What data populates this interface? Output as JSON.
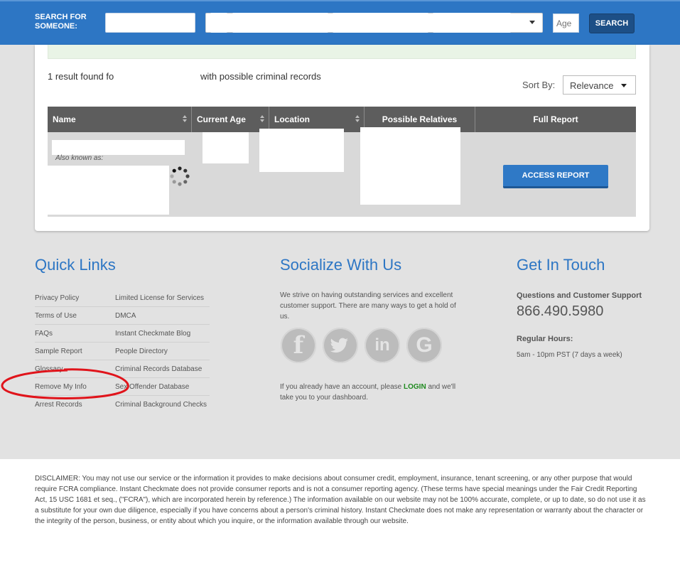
{
  "header": {
    "search_label": "SEARCH FOR SOMEONE:",
    "age_placeholder": "Age",
    "search_button": "SEARCH"
  },
  "results": {
    "count_text": "1 result found fo",
    "count_suffix": "with possible criminal records",
    "sort_label": "Sort By:",
    "sort_value": "Relevance",
    "columns": [
      "Name",
      "Current Age",
      "Location",
      "Possible Relatives",
      "Full Report"
    ],
    "row": {
      "aka_label": "Also known as:",
      "access_button": "ACCESS REPORT"
    }
  },
  "quick_links": {
    "title": "Quick Links",
    "left": [
      "Privacy Policy",
      "Terms of Use",
      "FAQs",
      "Sample Report",
      "Glossary",
      "Remove My Info",
      "Arrest Records"
    ],
    "right": [
      "Limited License for Services",
      "DMCA",
      "Instant Checkmate Blog",
      "People Directory",
      "Criminal Records Database",
      "Sex Offender Database",
      "Criminal Background Checks"
    ]
  },
  "social": {
    "title": "Socialize With Us",
    "text": "We strive on having outstanding services and excellent customer support. There are many ways to get a hold of us.",
    "icons": [
      "facebook-icon",
      "twitter-icon",
      "linkedin-icon",
      "google-icon"
    ],
    "login_prefix": "If you already have an account, please",
    "login_link": "LOGIN",
    "login_suffix": "and we'll take you to your dashboard."
  },
  "contact": {
    "title": "Get In Touch",
    "support_label": "Questions and Customer Support",
    "phone": "866.490.5980",
    "hours_label": "Regular Hours:",
    "hours_value": "5am - 10pm PST (7 days a week)"
  },
  "disclaimer": "DISCLAIMER: You may not use our service or the information it provides to make decisions about consumer credit, employment, insurance, tenant screening, or any other purpose that would require FCRA compliance. Instant Checkmate does not provide consumer reports and is not a consumer reporting agency. (These terms have special meanings under the Fair Credit Reporting Act, 15 USC 1681 et seq., (\"FCRA\"), which are incorporated herein by reference.) The information available on our website may not be 100% accurate, complete, or up to date, so do not use it as a substitute for your own due diligence, especially if you have concerns about a person's criminal history. Instant Checkmate does not make any representation or warranty about the character or the integrity of the person, business, or entity about which you inquire, or the information available through our website.",
  "colors": {
    "header_blue": "#2d76c4",
    "button_dark": "#1d4f86",
    "table_header": "#5d5d5d",
    "link_green": "#1f8a1f",
    "annotation_red": "#e0141b"
  }
}
